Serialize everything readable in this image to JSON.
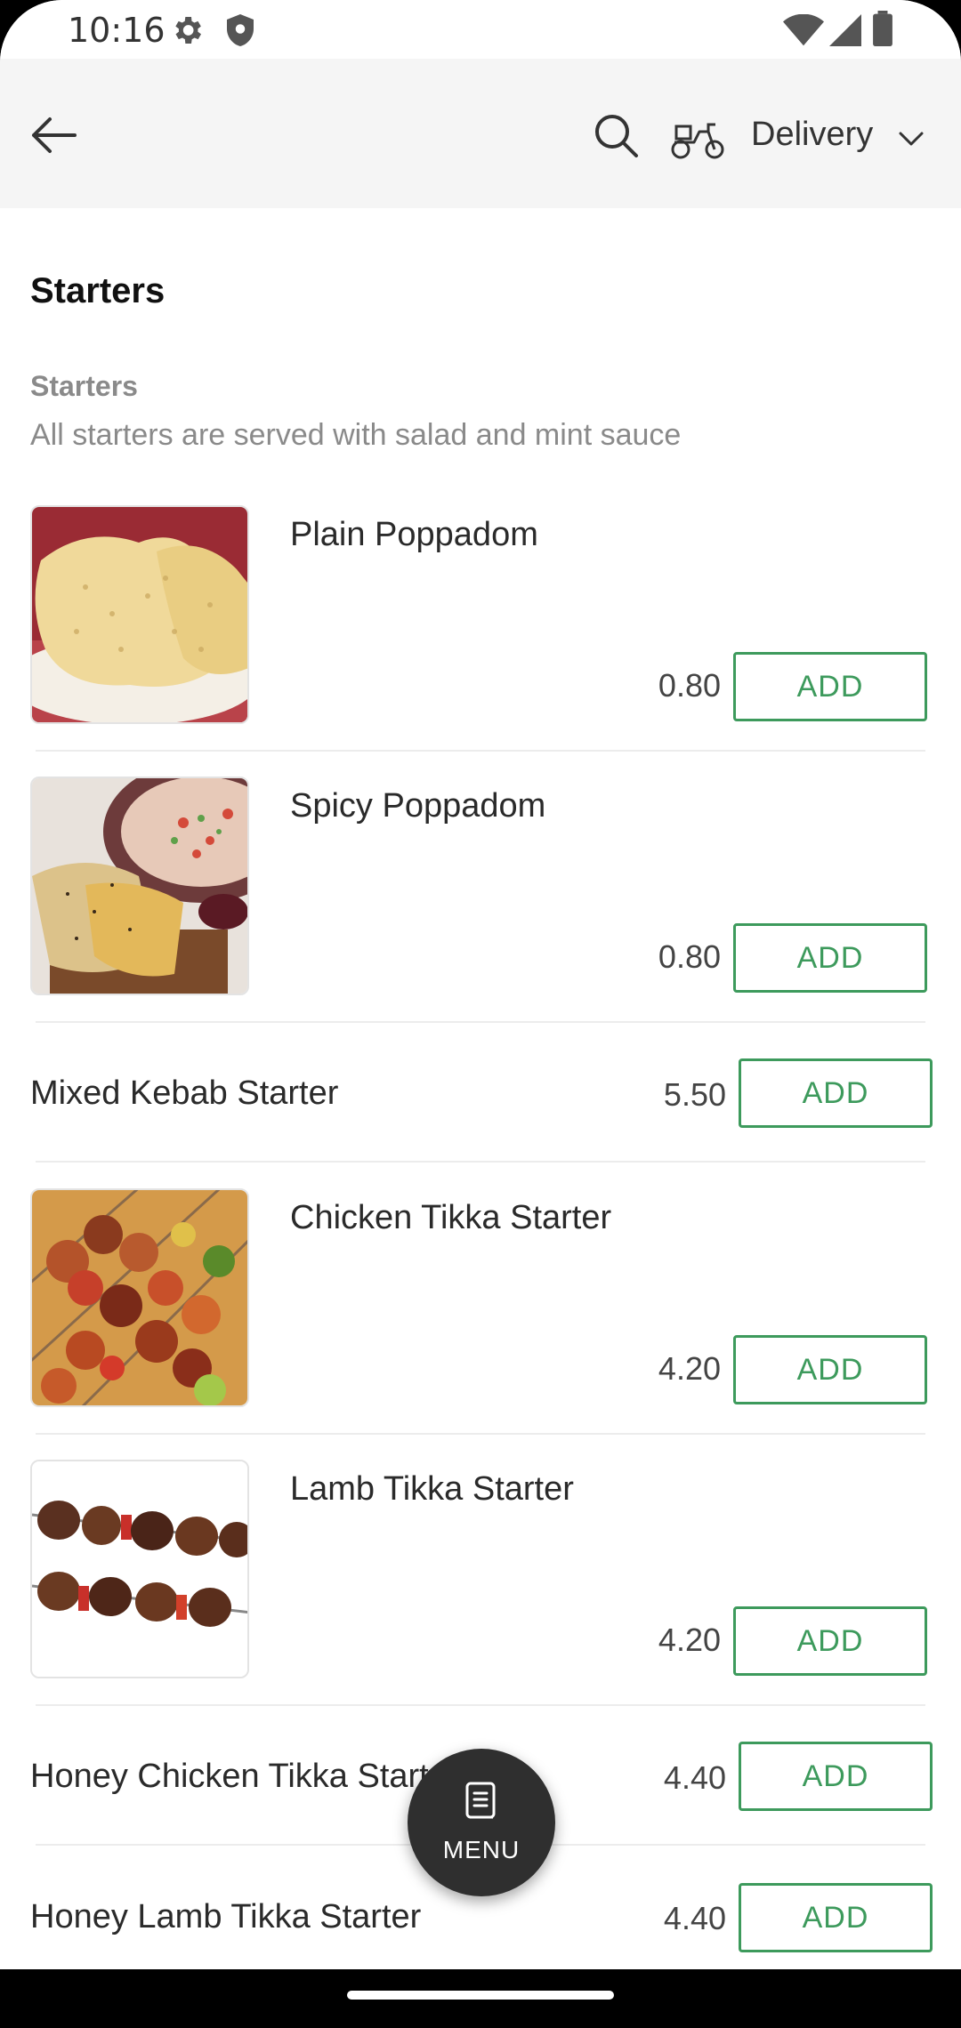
{
  "status_bar": {
    "time": "10:16",
    "icons": [
      "settings-icon",
      "shield-icon",
      "wifi-icon",
      "signal-icon",
      "battery-icon"
    ]
  },
  "header": {
    "back_icon": "back-arrow-icon",
    "search_icon": "search-icon",
    "delivery_icon": "scooter-icon",
    "delivery_label": "Delivery",
    "dropdown_icon": "chevron-down-icon"
  },
  "section": {
    "title": "Starters",
    "category_name": "Starters",
    "category_description": "All starters are served with salad and mint sauce"
  },
  "items": [
    {
      "name": "Plain Poppadom",
      "price": "0.80",
      "add_label": "ADD",
      "has_image": true,
      "image": "poppadom-photo"
    },
    {
      "name": "Spicy Poppadom",
      "price": "0.80",
      "add_label": "ADD",
      "has_image": true,
      "image": "spicy-poppadom-photo"
    },
    {
      "name": "Mixed Kebab Starter",
      "price": "5.50",
      "add_label": "ADD",
      "has_image": false
    },
    {
      "name": "Chicken Tikka Starter",
      "price": "4.20",
      "add_label": "ADD",
      "has_image": true,
      "image": "chicken-tikka-photo"
    },
    {
      "name": "Lamb Tikka Starter",
      "price": "4.20",
      "add_label": "ADD",
      "has_image": true,
      "image": "lamb-tikka-photo"
    },
    {
      "name": "Honey Chicken Tikka Starter",
      "price": "4.40",
      "add_label": "ADD",
      "has_image": false
    },
    {
      "name": "Honey Lamb Tikka Starter",
      "price": "4.40",
      "add_label": "ADD",
      "has_image": false
    }
  ],
  "fab": {
    "label": "MENU",
    "icon": "menu-book-icon"
  },
  "colors": {
    "accent": "#3d9a5c",
    "header_bg": "#f5f5f5",
    "fab_bg": "#2f2f2f"
  }
}
